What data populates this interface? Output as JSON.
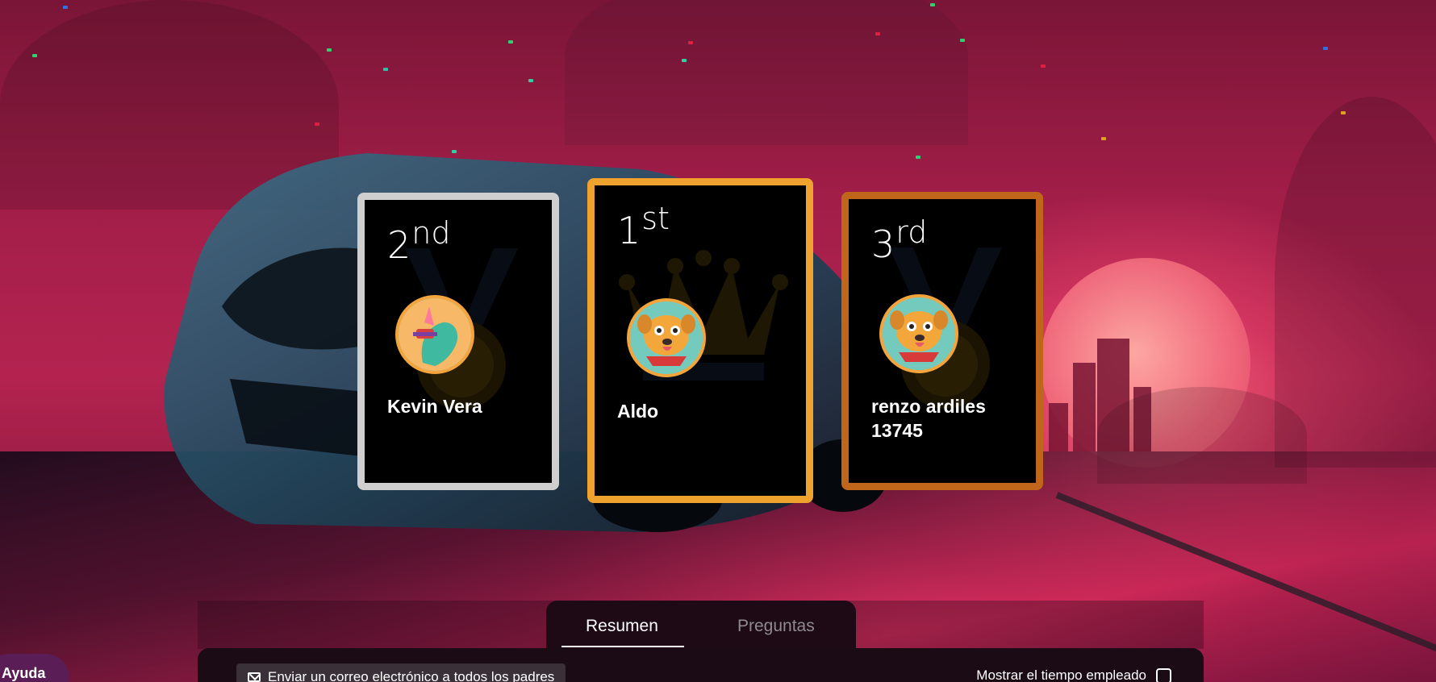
{
  "podium": [
    {
      "rank_number": "2",
      "rank_suffix": "nd",
      "player_name": "Kevin Vera",
      "avatar": "unicorn-avatar-icon",
      "border_color": "#cfcfcf"
    },
    {
      "rank_number": "1",
      "rank_suffix": "st",
      "player_name": "Aldo",
      "avatar": "pug-avatar-icon",
      "border_color": "#f0a22e"
    },
    {
      "rank_number": "3",
      "rank_suffix": "rd",
      "player_name": "renzo ardiles 13745",
      "avatar": "pug-avatar-icon",
      "border_color": "#c0661a"
    }
  ],
  "tabs": {
    "resumen": "Resumen",
    "preguntas": "Preguntas"
  },
  "actions": {
    "email_all_parents": "Enviar un correo electrónico a todos los padres",
    "show_time_spent": "Mostrar el tiempo empleado"
  },
  "help": {
    "label": "Ayuda"
  },
  "colors": {
    "gold": "#f0a22e",
    "silver": "#cfcfcf",
    "bronze": "#c0661a",
    "help_button": "#5b1d56"
  }
}
